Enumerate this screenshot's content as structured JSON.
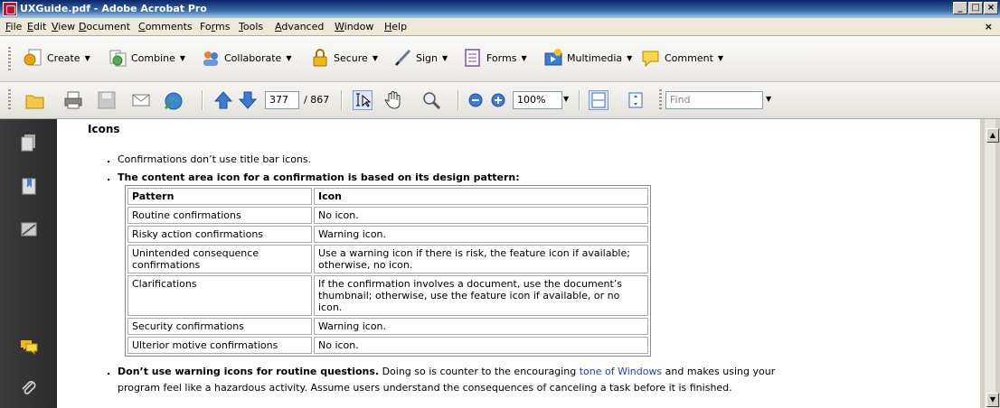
{
  "window": {
    "title": "UXGuide.pdf - Adobe Acrobat Pro"
  },
  "menu": {
    "items": [
      {
        "label": "File",
        "u": "F",
        "rest": "ile"
      },
      {
        "label": "Edit",
        "u": "E",
        "rest": "dit"
      },
      {
        "label": "View",
        "u": "V",
        "rest": "iew"
      },
      {
        "label": "Document",
        "u": "D",
        "rest": "ocument"
      },
      {
        "label": "Comments",
        "u": "C",
        "rest": "omments"
      },
      {
        "label": "Forms",
        "pre": "Fo",
        "u": "r",
        "rest": "ms"
      },
      {
        "label": "Tools",
        "u": "T",
        "rest": "ools"
      },
      {
        "label": "Advanced",
        "u": "A",
        "rest": "dvanced"
      },
      {
        "label": "Window",
        "u": "W",
        "rest": "indow"
      },
      {
        "label": "Help",
        "u": "H",
        "rest": "elp"
      }
    ],
    "close": "×"
  },
  "tasks": {
    "create": "Create",
    "combine": "Combine",
    "collaborate": "Collaborate",
    "secure": "Secure",
    "sign": "Sign",
    "forms": "Forms",
    "multimedia": "Multimedia",
    "comment": "Comment",
    "caret": "▼"
  },
  "nav": {
    "page": "377",
    "total": "/ 867",
    "zoom": "100%",
    "find_placeholder": "Find"
  },
  "doc": {
    "heading": "Icons",
    "bullet1": "Confirmations don’t use title bar icons.",
    "bullet2": "The content area icon for a confirmation is based on its design pattern:",
    "table": {
      "headers": [
        "Pattern",
        "Icon"
      ],
      "rows": [
        [
          "Routine confirmations",
          "No icon."
        ],
        [
          "Risky action confirmations",
          "Warning icon."
        ],
        [
          "Unintended consequence confirmations",
          "Use a warning icon if there is risk, the feature icon if available; otherwise, no icon."
        ],
        [
          "Clarifications",
          "If the confirmation involves a document, use the document’s thumbnail; otherwise, use the feature icon if available, or no icon."
        ],
        [
          "Security confirmations",
          "Warning icon."
        ],
        [
          "Ulterior motive confirmations",
          "No icon."
        ]
      ]
    },
    "bullet3_bold": "Don’t use warning icons for routine questions.",
    "bullet3_text1": " Doing so is counter to the encouraging ",
    "bullet3_link": "tone of Windows",
    "bullet3_text2": " and makes using your",
    "bullet3_line2": "program feel like a hazardous activity. Assume users understand the consequences of canceling a task before it is finished."
  },
  "colors": {
    "accent_title": "#0a246a",
    "link": "#1a3fd0",
    "acrobat_red": "#c8102e"
  }
}
